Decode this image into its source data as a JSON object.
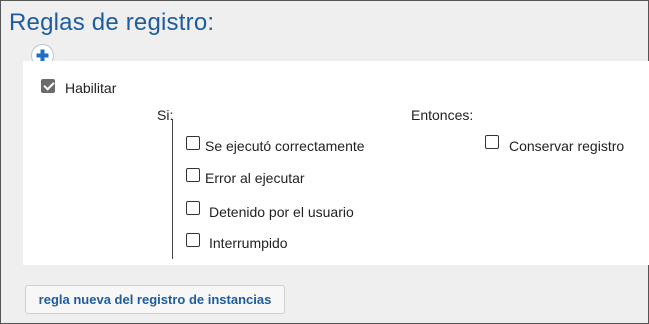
{
  "header": {
    "title": "Reglas de registro:"
  },
  "toolbar": {
    "add_icon": "plus-icon"
  },
  "rule": {
    "enable": {
      "label": "Habilitar",
      "checked": true
    },
    "if_label": "Si:",
    "then_label": "Entonces:",
    "conditions": [
      {
        "label": "Se ejecutó correctamente",
        "checked": false
      },
      {
        "label": "Error al ejecutar",
        "checked": false
      },
      {
        "label": "Detenido por el usuario",
        "checked": false
      },
      {
        "label": "Interrumpido",
        "checked": false
      }
    ],
    "action": {
      "label": "Conservar registro",
      "checked": false
    }
  },
  "footer": {
    "new_rule_label": "regla nueva del registro de instancias"
  },
  "colors": {
    "accent": "#1e5c9e",
    "plus": "#1e6fc4"
  }
}
